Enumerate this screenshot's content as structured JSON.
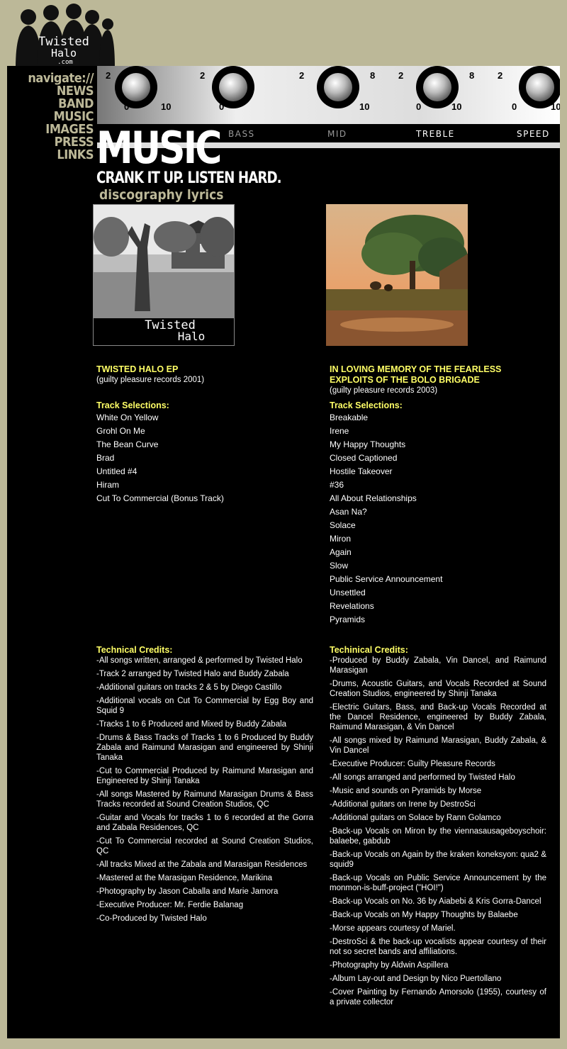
{
  "site": {
    "logo_text_line1": "Twisted",
    "logo_text_line2": "Halo",
    "logo_text_line3": ".com"
  },
  "nav": {
    "label": "navigate://",
    "items": [
      "NEWS",
      "BAND",
      "MUSIC",
      "IMAGES",
      "PRESS",
      "LINKS"
    ]
  },
  "amp": {
    "knob_labels": [
      "BASS",
      "MID",
      "TREBLE",
      "SPEED"
    ]
  },
  "page": {
    "title": "MUSIC",
    "tagline": "CRANK IT UP. LISTEN HARD.",
    "subnav": [
      "discography",
      "lyrics"
    ]
  },
  "album1": {
    "cover_text_line1": "Twisted",
    "cover_text_line2": "Halo",
    "title": "TWISTED HALO EP",
    "label": "(guilty pleasure records 2001)",
    "tracks_heading": "Track Selections:",
    "tracks": [
      "White On Yellow",
      "Grohl On Me",
      "The Bean Curve",
      "Brad",
      "Untitled #4",
      "Hiram",
      "Cut To Commercial (Bonus Track)"
    ],
    "credits_heading": "Technical Credits:",
    "credits": [
      "-All songs written, arranged & performed by Twisted Halo",
      "-Track 2 arranged by Twisted Halo and Buddy Zabala",
      "-Additional guitars on tracks 2 & 5 by Diego Castillo",
      "-Additional vocals on Cut To Commercial by Egg Boy and Squid 9",
      "-Tracks 1 to 6 Produced and Mixed by Buddy Zabala",
      "-Drums & Bass Tracks of Tracks 1 to 6 Produced by Buddy Zabala and Raimund Marasigan and engineered by Shinji Tanaka",
      "-Cut to Commercial Produced by Raimund Marasigan and Engineered by Shinji Tanaka",
      "-All songs Mastered by Raimund Marasigan Drums & Bass Tracks recorded at Sound Creation Studios, QC",
      "-Guitar and Vocals for tracks 1 to 6 recorded at the Gorra and Zabala Residences, QC",
      "-Cut To Commercial recorded at Sound Creation Studios, QC",
      "-All tracks Mixed at the Zabala and Marasigan Residences",
      "-Mastered at the Marasigan Residence, Marikina",
      "-Photography by Jason Caballa and Marie Jamora",
      "-Executive Producer: Mr. Ferdie Balanag",
      "-Co-Produced by Twisted Halo"
    ]
  },
  "album2": {
    "title": "IN LOVING MEMORY OF THE FEARLESS EXPLOITS OF THE BOLO BRIGADE",
    "label": "(guilty pleasure records 2003)",
    "tracks_heading": "Track Selections:",
    "tracks": [
      "Breakable",
      "Irene",
      "My Happy Thoughts",
      "Closed Captioned",
      "Hostile Takeover",
      "#36",
      "All About Relationships",
      "Asan Na?",
      "Solace",
      "Miron",
      "Again",
      "Slow",
      "Public Service Announcement",
      "Unsettled",
      "Revelations",
      "Pyramids"
    ],
    "credits_heading": "Techinical Credits:",
    "credits": [
      "-Produced by Buddy Zabala, Vin Dancel, and Raimund Marasigan",
      "-Drums, Acoustic Guitars, and Vocals Recorded at Sound Creation Studios, engineered by Shinji Tanaka",
      "-Electric Guitars, Bass, and Back-up Vocals Recorded at the Dancel Residence, engineered by Buddy Zabala, Raimund Marasigan, & Vin Dancel",
      "-All songs mixed by Raimund Marasigan, Buddy Zabala, & Vin Dancel",
      "-Executive Producer: Guilty Pleasure Records",
      "-All songs arranged and performed by Twisted Halo",
      "-Music and sounds on Pyramids by Morse",
      "-Additional guitars on Irene by DestroSci",
      "-Additional guitars on Solace by Rann Golamco",
      "-Back-up Vocals on Miron by the viennasausageboyschoir: balaebe, gabdub",
      "-Back-up Vocals on Again by the kraken koneksyon: qua2 & squid9",
      "-Back-up Vocals on Public Service Announcement by the monmon-is-buff-project (\"HOI!\")",
      "-Back-up Vocals on No. 36 by Aiabebi & Kris Gorra-Dancel",
      "-Back-up Vocals on My Happy Thoughts by Balaebe",
      "-Morse appears courtesy of Mariel.",
      "-DestroSci & the back-up vocalists appear courtesy of their not so secret bands and affiliations.",
      "-Photography by Aldwin Aspillera",
      "-Album Lay-out and Design by Nico Puertollano",
      "-Cover Painting by Fernando Amorsolo (1955), courtesy of a private collector"
    ]
  },
  "colors": {
    "background": "#bcb898",
    "panel": "#000000",
    "accent_yellow": "#ffff66",
    "nav_text": "#bcb898"
  }
}
